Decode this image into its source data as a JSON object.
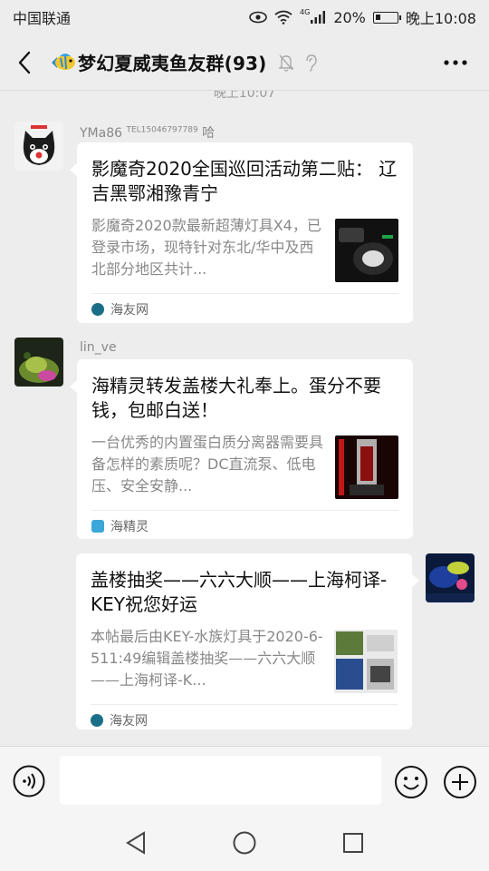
{
  "status_bar": {
    "carrier": "中国联通",
    "network": "4G",
    "battery": "20%",
    "time": "晚上10:08"
  },
  "header": {
    "title": "梦幻夏威夷鱼友群(93)"
  },
  "chat": {
    "time_divider": "晚上10:07",
    "messages": [
      {
        "sender": "YMa86",
        "sender_tel": "TEL15046797789",
        "sender_suffix": "哈",
        "card": {
          "title": "影魔奇2020全国巡回活动第二贴： 辽吉黑鄂湘豫青宁",
          "desc": "影魔奇2020款最新超薄灯具X4，已登录市场，现特针对东北/华中及西北部分地区共计...",
          "source": "海友网",
          "source_color": "#1a6f87"
        }
      },
      {
        "sender": "lin_ve",
        "card": {
          "title": "海精灵转发盖楼大礼奉上。蛋分不要钱，包邮白送！",
          "desc": "一台优秀的内置蛋白质分离器需要具备怎样的素质呢？DC直流泵、低电压、安全安静...",
          "source": "海精灵",
          "source_color": "#3aa7d8"
        }
      },
      {
        "sender": "",
        "card": {
          "title": "盖楼抽奖——六六大顺——上海柯译-KEY祝您好运",
          "desc": "本帖最后由KEY-水族灯具于2020-6-511:49编辑盖楼抽奖——六六大顺——上海柯译-K...",
          "source": "海友网",
          "source_color": "#1a6f87"
        }
      }
    ]
  },
  "input": {
    "placeholder": "",
    "value": ""
  },
  "colors": {
    "background": "#ededed",
    "card": "#ffffff",
    "muted_text": "#888888"
  }
}
